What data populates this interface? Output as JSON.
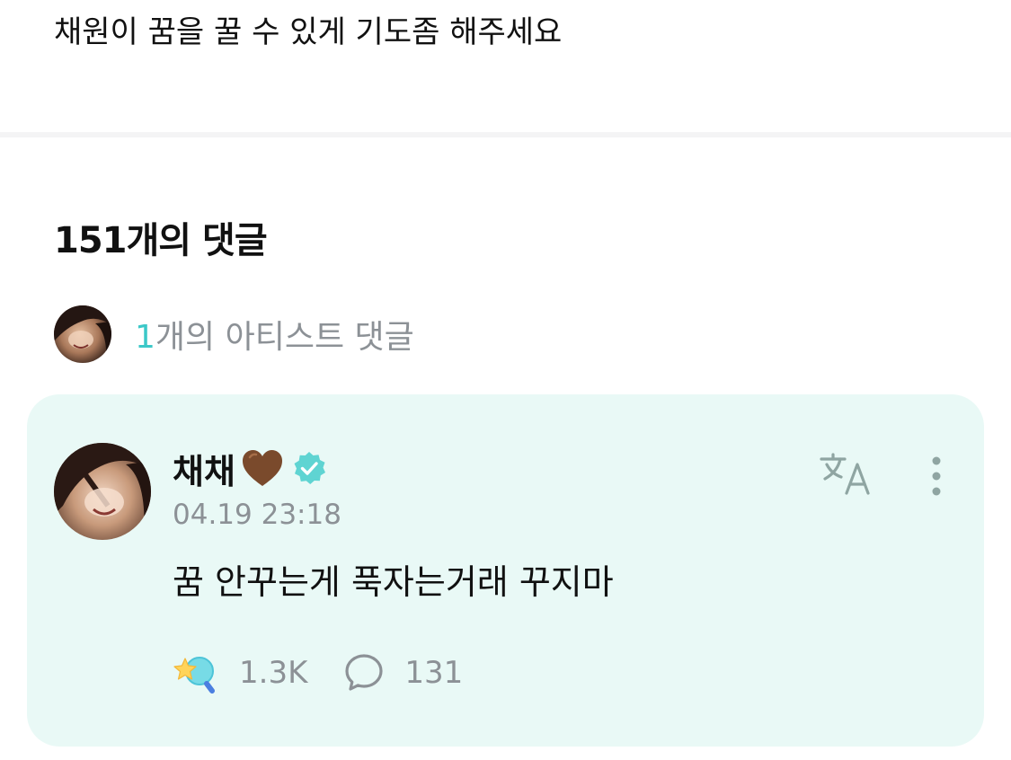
{
  "post": {
    "text": "채원이 꿈을 꿀 수 있게 기도좀 해주세요"
  },
  "comments": {
    "title": "151개의 댓글",
    "artist_summary": {
      "count": "1",
      "label": "개의 아티스트 댓글"
    }
  },
  "artist_comment": {
    "author_name": "채채",
    "name_emoji": "brown-heart-icon",
    "verified_icon": "verified-badge-icon",
    "timestamp": "04.19 23:18",
    "body": "꿈 안꾸는게 푹자는거래 꾸지마",
    "like_count": "1.3K",
    "reply_count": "131",
    "translate_icon": "translate-icon",
    "more_icon": "more-vertical-icon"
  },
  "colors": {
    "accent": "#3cc8c8",
    "card_background": "#e9f9f6",
    "muted_text": "#8c9196",
    "verified": "#5fd4d2",
    "heart": "#7a4a2c"
  }
}
